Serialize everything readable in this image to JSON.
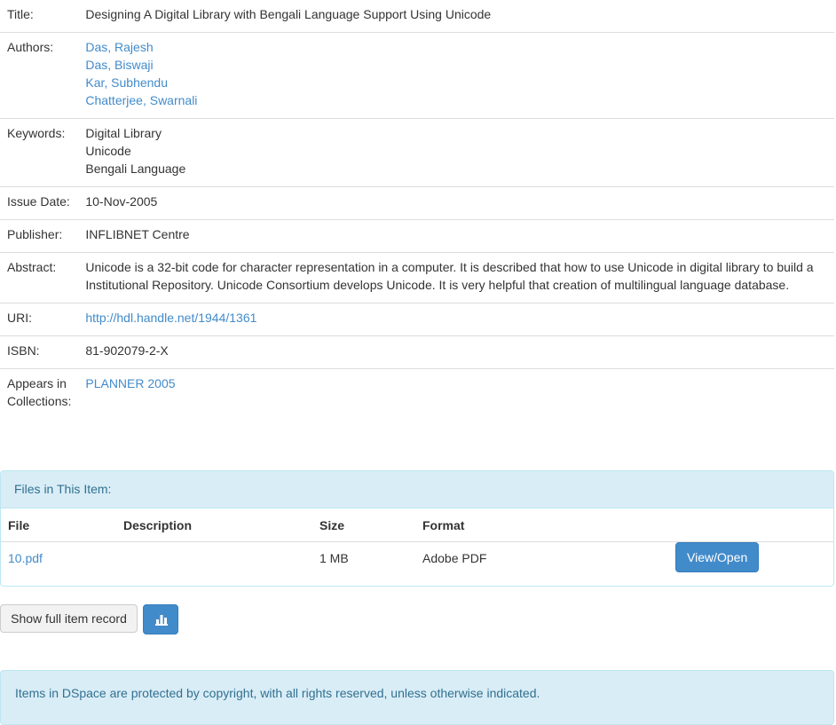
{
  "metadata": {
    "title_label": "Title:",
    "title": "Designing A Digital Library with Bengali Language Support Using Unicode",
    "authors_label": "Authors:",
    "authors": [
      "Das, Rajesh",
      "Das, Biswaji",
      "Kar, Subhendu",
      "Chatterjee, Swarnali"
    ],
    "keywords_label": "Keywords:",
    "keywords": [
      "Digital Library",
      "Unicode",
      "Bengali Language"
    ],
    "issue_date_label": "Issue Date:",
    "issue_date": "10-Nov-2005",
    "publisher_label": "Publisher:",
    "publisher": "INFLIBNET Centre",
    "abstract_label": "Abstract:",
    "abstract": "Unicode is a 32-bit code for character representation in a computer. It is described that how to use Unicode in digital library to build a Institutional Repository. Unicode Consortium develops Unicode. It is very helpful that creation of multilingual language database.",
    "uri_label": "URI:",
    "uri": "http://hdl.handle.net/1944/1361",
    "isbn_label": "ISBN:",
    "isbn": "81-902079-2-X",
    "collections_label": "Appears in Collections:",
    "collection": "PLANNER 2005"
  },
  "files": {
    "heading": "Files in This Item:",
    "columns": [
      "File",
      "Description",
      "Size",
      "Format"
    ],
    "rows": [
      {
        "file": "10.pdf",
        "description": "",
        "size": "1 MB",
        "format": "Adobe PDF",
        "action": "View/Open"
      }
    ]
  },
  "actions": {
    "full_record": "Show full item record",
    "stats_icon": "bar-chart-icon"
  },
  "footer": {
    "text": "Items in DSpace are protected by copyright, with all rights reserved, unless otherwise indicated."
  }
}
